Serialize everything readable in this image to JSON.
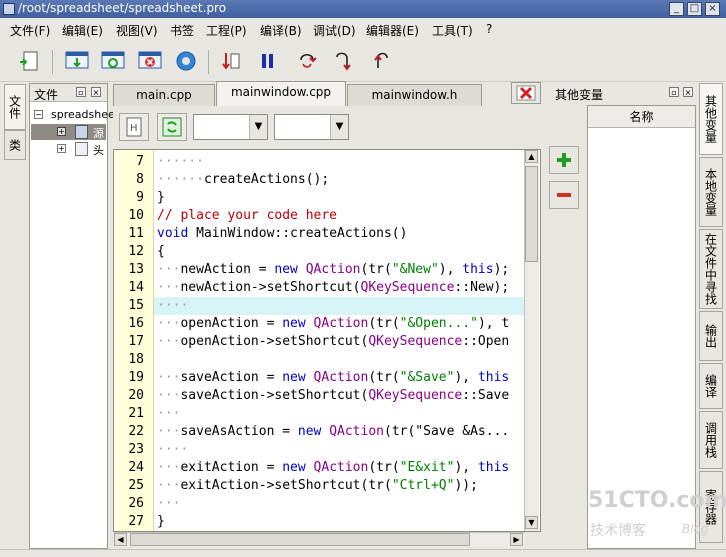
{
  "window": {
    "title": "/root/spreadsheet/spreadsheet.pro"
  },
  "menu": [
    {
      "label": "文件(F)"
    },
    {
      "label": "编辑(E)"
    },
    {
      "label": "视图(V)"
    },
    {
      "label": "书签"
    },
    {
      "label": "工程(P)"
    },
    {
      "label": "编译(B)"
    },
    {
      "label": "调试(D)"
    },
    {
      "label": "编辑器(E)"
    },
    {
      "label": "工具(T)"
    },
    {
      "label": "?"
    }
  ],
  "left_tabs": [
    {
      "label": "文件"
    },
    {
      "label": "类"
    }
  ],
  "file_panel": {
    "title": "文件",
    "tree": [
      {
        "label": "spreadsheet"
      },
      {
        "label": "源"
      },
      {
        "label": "头"
      }
    ]
  },
  "editor_tabs": [
    {
      "label": "main.cpp"
    },
    {
      "label": "mainwindow.cpp"
    },
    {
      "label": "mainwindow.h"
    }
  ],
  "code_lines": [
    {
      "n": "7",
      "text": "······"
    },
    {
      "n": "8",
      "text": "······createActions();"
    },
    {
      "n": "9",
      "text": "}"
    },
    {
      "n": "10",
      "text": "// place your code here"
    },
    {
      "n": "11",
      "text": "void MainWindow::createActions()"
    },
    {
      "n": "12",
      "text": "{"
    },
    {
      "n": "13",
      "text": "···newAction = new QAction(tr(\"&New\"), this);"
    },
    {
      "n": "14",
      "text": "···newAction->setShortcut(QKeySequence::New);"
    },
    {
      "n": "15",
      "text": "····"
    },
    {
      "n": "16",
      "text": "···openAction = new QAction(tr(\"&Open...\"), t"
    },
    {
      "n": "17",
      "text": "···openAction->setShortcut(QKeySequence::Open"
    },
    {
      "n": "18",
      "text": ""
    },
    {
      "n": "19",
      "text": "···saveAction = new QAction(tr(\"&Save\"), this"
    },
    {
      "n": "20",
      "text": "···saveAction->setShortcut(QKeySequence::Save"
    },
    {
      "n": "21",
      "text": "···"
    },
    {
      "n": "22",
      "text": "···saveAsAction = new QAction(tr(\"Save &As..."
    },
    {
      "n": "23",
      "text": "····"
    },
    {
      "n": "24",
      "text": "···exitAction = new QAction(tr(\"E&xit\"), this"
    },
    {
      "n": "25",
      "text": "···exitAction->setShortcut(tr(\"Ctrl+Q\"));"
    },
    {
      "n": "26",
      "text": "···"
    },
    {
      "n": "27",
      "text": "}"
    }
  ],
  "right_panel": {
    "title": "其他变量",
    "column": "名称"
  },
  "right_tabs": [
    {
      "label": "其他变量"
    },
    {
      "label": "本地变量"
    },
    {
      "label": "在文件中寻找"
    },
    {
      "label": "输出"
    },
    {
      "label": "编译"
    },
    {
      "label": "调用栈"
    },
    {
      "label": "寄存器"
    }
  ],
  "watermark": {
    "main": "51CTO.com",
    "sub": "技术博客",
    "tag": "Blog"
  },
  "colors": {
    "title_bar": "#4a69a8",
    "gutter": "#ffffd9",
    "current_line": "#d6f3f6",
    "keyword": "#0000c8",
    "comment": "#c00000",
    "string": "#008000",
    "class_name": "#880088"
  }
}
